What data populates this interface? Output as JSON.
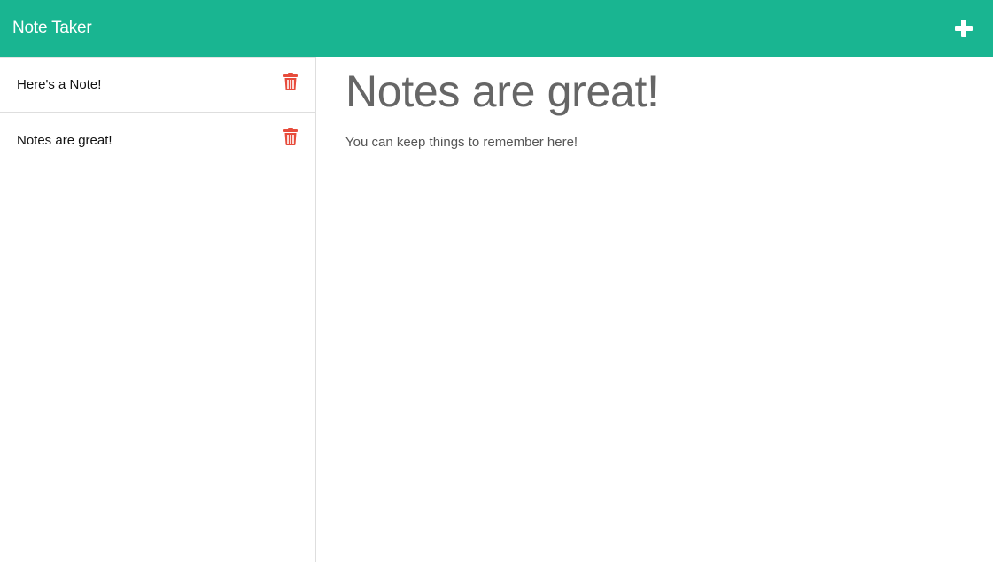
{
  "navbar": {
    "brand": "Note Taker",
    "add_icon": "plus-icon",
    "color": "#19b591"
  },
  "sidebar": {
    "notes": [
      {
        "title": "Here's a Note!",
        "delete_icon": "trash-icon"
      },
      {
        "title": "Notes are great!",
        "delete_icon": "trash-icon"
      }
    ]
  },
  "active_note": {
    "title": "Notes are great!",
    "text": "You can keep things to remember here!"
  },
  "colors": {
    "accent": "#19b591",
    "danger": "#e74c3c"
  }
}
